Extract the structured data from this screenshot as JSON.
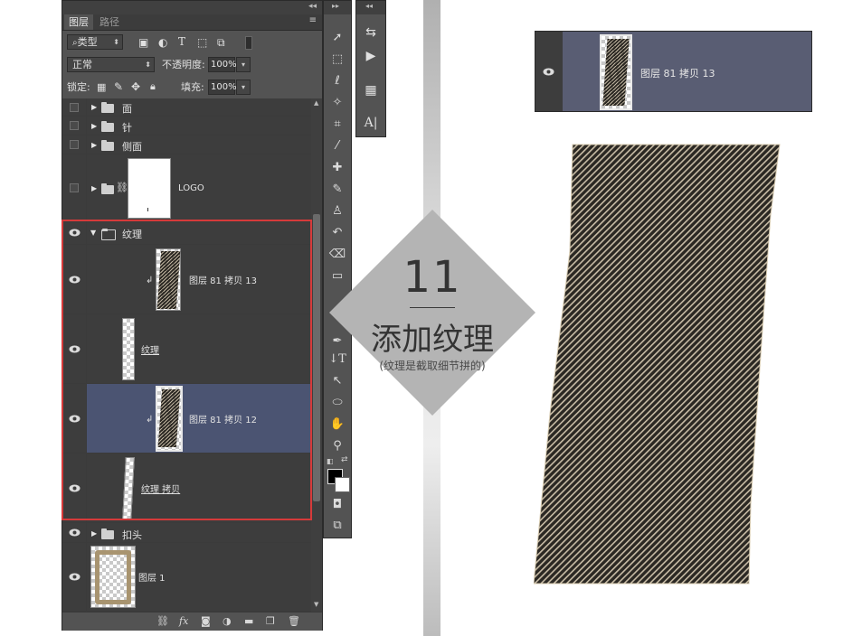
{
  "layers_panel": {
    "tabs": [
      {
        "label": "图层",
        "active": true
      },
      {
        "label": "路径",
        "active": false
      }
    ],
    "filter_kind_label": "类型",
    "blend_mode": "正常",
    "opacity_label": "不透明度:",
    "opacity_value": "100%",
    "lock_label": "锁定:",
    "fill_label": "填充:",
    "fill_value": "100%",
    "layers": [
      {
        "name": "面",
        "type": "group",
        "visible": false
      },
      {
        "name": "针",
        "type": "group",
        "visible": false
      },
      {
        "name": "侧面",
        "type": "group",
        "visible": false
      },
      {
        "name": "LOGO",
        "type": "group",
        "visible": false,
        "linked": true
      },
      {
        "name": "纹理",
        "type": "group",
        "visible": true,
        "expanded": true
      },
      {
        "name": "图层 81 拷贝 13",
        "type": "layer",
        "visible": true,
        "clipped": true
      },
      {
        "name": "纹理",
        "type": "layer",
        "visible": true
      },
      {
        "name": "图层 81 拷贝 12",
        "type": "layer",
        "visible": true,
        "clipped": true,
        "selected": true
      },
      {
        "name": "纹理 拷贝",
        "type": "layer",
        "visible": true
      },
      {
        "name": "扣头",
        "type": "group",
        "visible": true
      },
      {
        "name": "图层 1",
        "type": "layer",
        "visible": true
      }
    ],
    "footer_icons": [
      "link-icon",
      "fx-icon",
      "mask-icon",
      "adjustment-icon",
      "group-icon",
      "new-layer-icon",
      "trash-icon"
    ]
  },
  "diamond": {
    "number": "11",
    "title": "添加纹理",
    "subtitle": "(纹理是截取细节拼的)"
  },
  "preview": {
    "layer_name": "图层 81 拷贝 13"
  },
  "colors": {
    "panel_bg": "#535353",
    "selected_row": "#4b5472",
    "highlight_box": "#d63a3a",
    "diamond": "#b4b4b4"
  }
}
